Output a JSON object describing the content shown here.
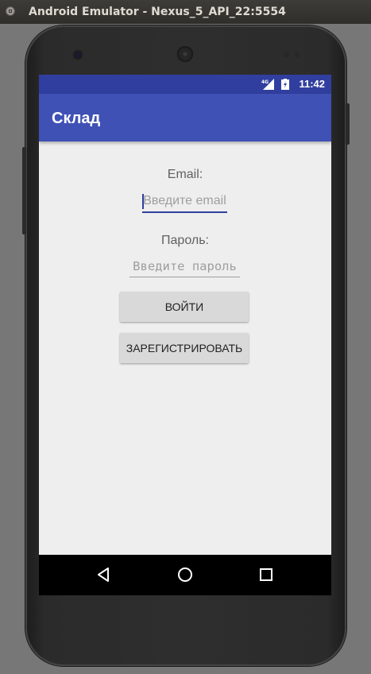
{
  "window": {
    "title": "Android Emulator - Nexus_5_API_22:5554"
  },
  "status_bar": {
    "network": "4G",
    "time": "11:42"
  },
  "app_bar": {
    "title": "Склад"
  },
  "form": {
    "email_label": "Email:",
    "email_placeholder": "Введите email",
    "password_label": "Пароль:",
    "password_placeholder": "Введите пароль",
    "login_button": "ВОЙТИ",
    "register_button": "ЗАРЕГИСТРИРОВАТЬ"
  },
  "colors": {
    "status_bar": "#303f9f",
    "app_bar": "#3f51b5",
    "accent": "#303f9f",
    "background": "#eeeeee"
  },
  "nav_bar": {
    "icons": [
      "back-icon",
      "home-icon",
      "recents-icon"
    ]
  }
}
